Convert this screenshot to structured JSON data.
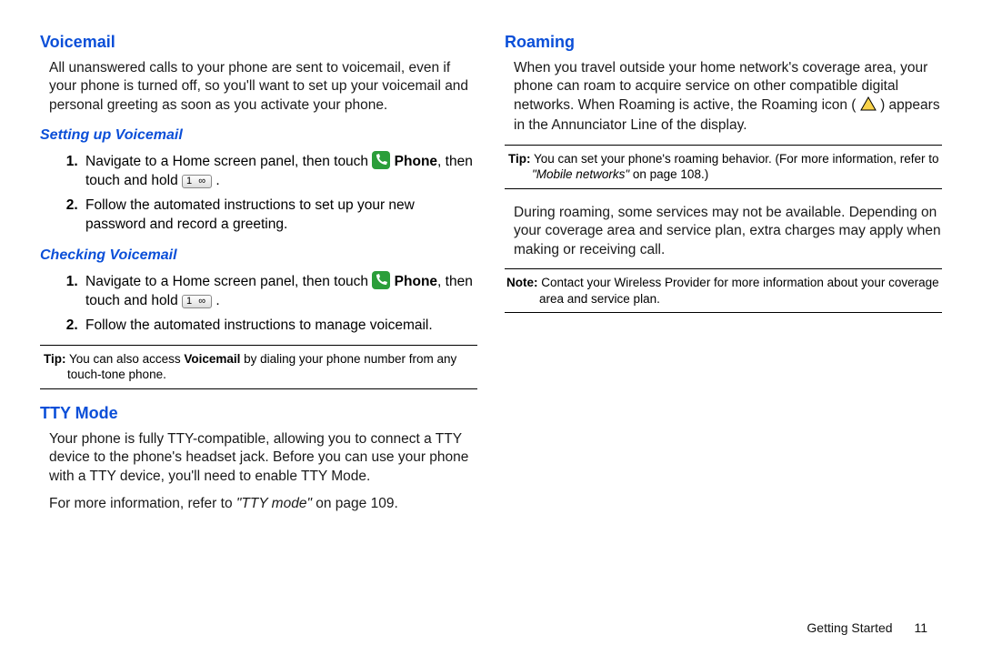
{
  "left": {
    "voicemail": {
      "heading": "Voicemail",
      "intro": "All unanswered calls to your phone are sent to voicemail, even if your phone is turned off, so you'll want to set up your voicemail and personal greeting as soon as you activate your phone.",
      "setup": {
        "heading": "Setting up Voicemail",
        "step1_a": "Navigate to a Home screen panel, then touch ",
        "step1_phone": " Phone",
        "step1_b": ", then touch and hold ",
        "step1_c": " .",
        "step2": "Follow the automated instructions to set up your new password and record a greeting."
      },
      "check": {
        "heading": "Checking Voicemail",
        "step1_a": "Navigate to a Home screen panel, then touch ",
        "step1_phone": " Phone",
        "step1_b": ", then touch and hold ",
        "step1_c": " .",
        "step2": "Follow the automated instructions to manage voicemail."
      },
      "tip_label": "Tip:",
      "tip_pre": " You can also access ",
      "tip_vm": "Voicemail",
      "tip_post": " by dialing your phone number from any touch-tone phone."
    },
    "tty": {
      "heading": "TTY Mode",
      "para1": "Your phone is fully TTY-compatible, allowing you to connect a TTY device to the phone's headset jack. Before you can use your phone with a TTY device, you'll need to enable TTY Mode.",
      "para2_a": "For more information, refer to ",
      "para2_ref": "\"TTY mode\"",
      "para2_b": " on page 109."
    }
  },
  "right": {
    "roaming": {
      "heading": "Roaming",
      "para1_a": "When you travel outside your home network's coverage area, your phone can roam to acquire service on other compatible digital networks. When Roaming is active, the Roaming icon ( ",
      "para1_b": " ) appears in the Annunciator Line of the display.",
      "tip_label": "Tip:",
      "tip_a": " You can set your phone's roaming behavior. (For more information, refer to ",
      "tip_ref": "\"Mobile networks\"",
      "tip_b": " on page 108.)",
      "para2": "During roaming, some services may not be available. Depending on your coverage area and service plan, extra charges may apply when making or receiving call.",
      "note_label": "Note:",
      "note": " Contact your Wireless Provider for more information about your coverage area and service plan."
    }
  },
  "footer": {
    "section": "Getting Started",
    "page": "11"
  },
  "icons": {
    "key1": "1 ∞"
  }
}
